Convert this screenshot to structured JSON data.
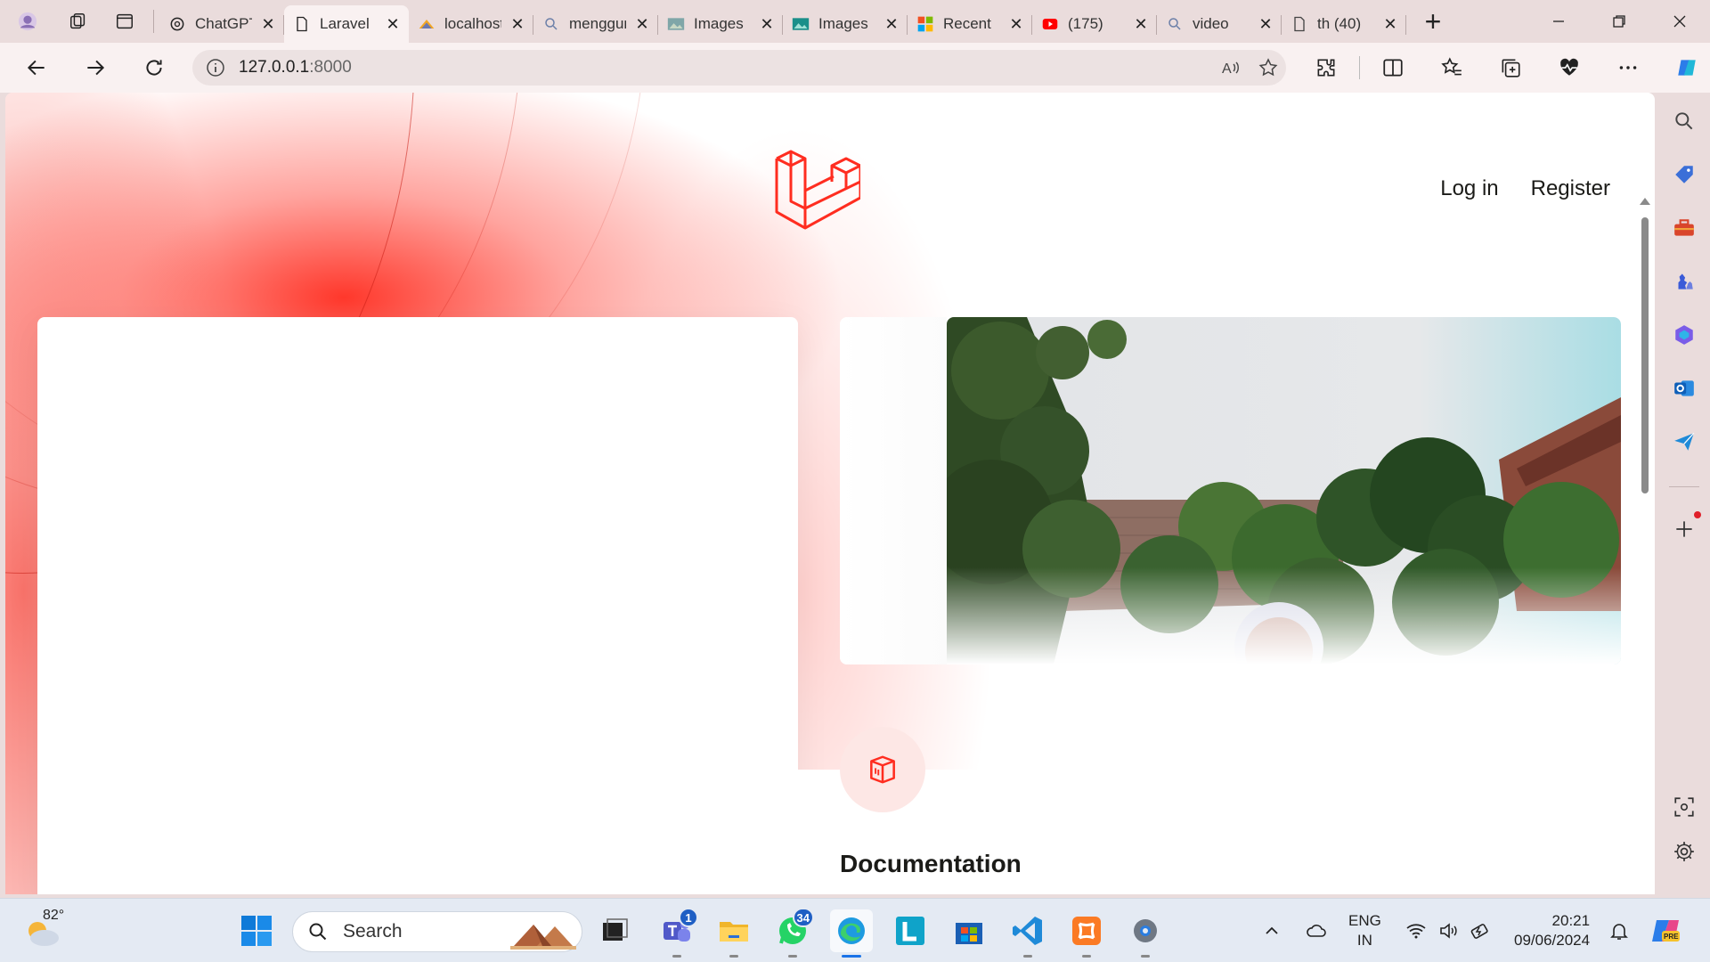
{
  "browser": {
    "tabs": [
      {
        "title": "ChatGPT",
        "icon": "chatgpt-icon",
        "active": false
      },
      {
        "title": "Laravel",
        "icon": "page-icon",
        "active": true
      },
      {
        "title": "localhost",
        "icon": "phpmyadmin-icon",
        "active": false
      },
      {
        "title": "menggunakan",
        "icon": "search-icon",
        "active": false
      },
      {
        "title": "Images",
        "icon": "image-icon",
        "active": false
      },
      {
        "title": "Images",
        "icon": "image-icon",
        "active": false
      },
      {
        "title": "Recent",
        "icon": "microsoft-icon",
        "active": false
      },
      {
        "title": "(175)",
        "icon": "youtube-icon",
        "active": false
      },
      {
        "title": "video",
        "icon": "search-icon",
        "active": false
      },
      {
        "title": "th (40)",
        "icon": "page-icon",
        "active": false
      }
    ],
    "address": {
      "host": "127.0.0.1",
      "port": ":8000"
    }
  },
  "page": {
    "nav": {
      "login": "Log in",
      "register": "Register"
    },
    "documentation_title": "Documentation"
  },
  "colors": {
    "accent": "#F53003",
    "laravel_red": "#FF2D20"
  },
  "taskbar": {
    "weather_temp": "82°",
    "search_placeholder": "Search",
    "teams_badge": "1",
    "whatsapp_badge": "34",
    "lang_line1": "ENG",
    "lang_line2": "IN",
    "time": "20:21",
    "date": "09/06/2024"
  }
}
